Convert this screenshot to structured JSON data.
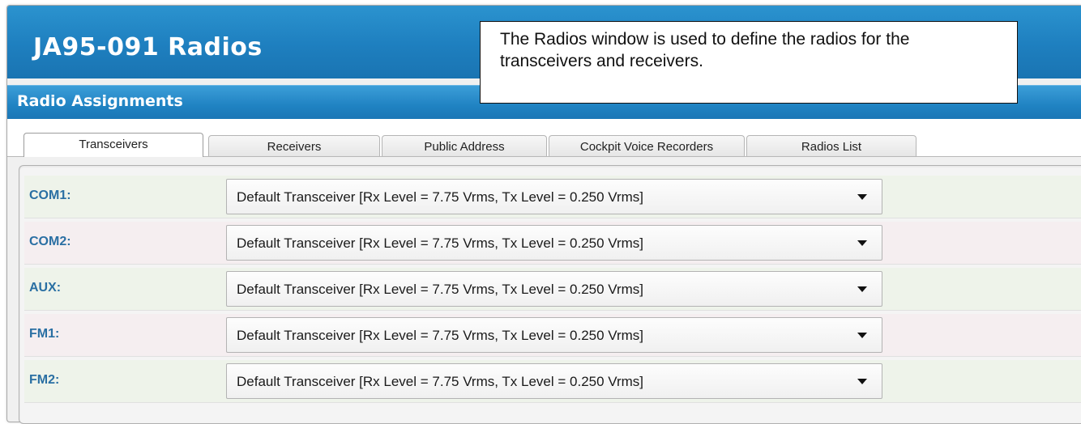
{
  "window": {
    "title": "JA95-091  Radios",
    "section_title": "Radio Assignments"
  },
  "tabs": [
    {
      "label": "Transceivers",
      "active": true
    },
    {
      "label": "Receivers",
      "active": false
    },
    {
      "label": "Public Address",
      "active": false
    },
    {
      "label": "Cockpit Voice Recorders",
      "active": false
    },
    {
      "label": "Radios List",
      "active": false
    }
  ],
  "rows": [
    {
      "label": "COM1:",
      "value": "Default Transceiver  [Rx Level = 7.75 Vrms,  Tx Level = 0.250 Vrms]"
    },
    {
      "label": "COM2:",
      "value": "Default Transceiver  [Rx Level = 7.75 Vrms,  Tx Level = 0.250 Vrms]"
    },
    {
      "label": "AUX:",
      "value": "Default Transceiver  [Rx Level = 7.75 Vrms,  Tx Level = 0.250 Vrms]"
    },
    {
      "label": "FM1:",
      "value": "Default Transceiver  [Rx Level = 7.75 Vrms,  Tx Level = 0.250 Vrms]"
    },
    {
      "label": "FM2:",
      "value": "Default Transceiver  [Rx Level = 7.75 Vrms,  Tx Level = 0.250 Vrms]"
    }
  ],
  "callout": {
    "text": "The Radios window is used to define the radios for the transceivers and receivers."
  },
  "colors": {
    "title_bar": "#1e7fbf",
    "label_text": "#2a6fa3",
    "row_green": "#eef3ea",
    "row_pink": "#f5eef0"
  },
  "icons": {
    "dropdown": "chevron-down-icon"
  }
}
